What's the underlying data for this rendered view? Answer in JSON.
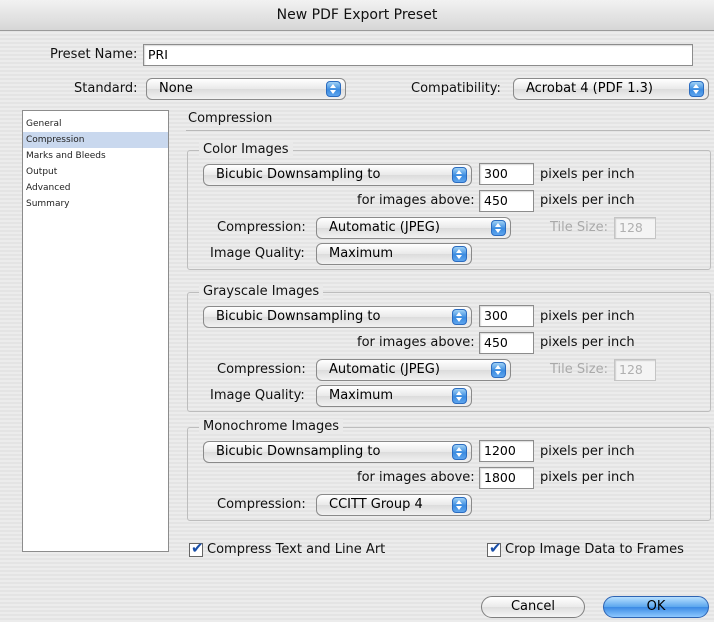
{
  "window": {
    "title": "New PDF Export Preset"
  },
  "preset": {
    "label": "Preset Name:",
    "value": "PRI"
  },
  "standard": {
    "label": "Standard:",
    "value": "None"
  },
  "compatibility": {
    "label": "Compatibility:",
    "value": "Acrobat 4 (PDF 1.3)"
  },
  "sidebar": {
    "items": [
      {
        "label": "General"
      },
      {
        "label": "Compression"
      },
      {
        "label": "Marks and Bleeds"
      },
      {
        "label": "Output"
      },
      {
        "label": "Advanced"
      },
      {
        "label": "Summary"
      }
    ],
    "selected": "Compression"
  },
  "section_title": "Compression",
  "color": {
    "title": "Color Images",
    "sampling": "Bicubic Downsampling to",
    "ppi": "300",
    "ppi_unit": "pixels per inch",
    "above_label": "for images above:",
    "above": "450",
    "above_unit": "pixels per inch",
    "compression_label": "Compression:",
    "compression": "Automatic (JPEG)",
    "tile_label": "Tile Size:",
    "tile": "128",
    "quality_label": "Image Quality:",
    "quality": "Maximum"
  },
  "gray": {
    "title": "Grayscale Images",
    "sampling": "Bicubic Downsampling to",
    "ppi": "300",
    "ppi_unit": "pixels per inch",
    "above_label": "for images above:",
    "above": "450",
    "above_unit": "pixels per inch",
    "compression_label": "Compression:",
    "compression": "Automatic (JPEG)",
    "tile_label": "Tile Size:",
    "tile": "128",
    "quality_label": "Image Quality:",
    "quality": "Maximum"
  },
  "mono": {
    "title": "Monochrome Images",
    "sampling": "Bicubic Downsampling to",
    "ppi": "1200",
    "ppi_unit": "pixels per inch",
    "above_label": "for images above:",
    "above": "1800",
    "above_unit": "pixels per inch",
    "compression_label": "Compression:",
    "compression": "CCITT Group 4"
  },
  "options": {
    "compress_text": {
      "label": "Compress Text and Line Art",
      "checked": true
    },
    "crop_image": {
      "label": "Crop Image Data to Frames",
      "checked": true
    }
  },
  "buttons": {
    "cancel": "Cancel",
    "ok": "OK"
  },
  "colors": {
    "accent": "#3b8ae4",
    "selection": "#c9d8ee"
  }
}
